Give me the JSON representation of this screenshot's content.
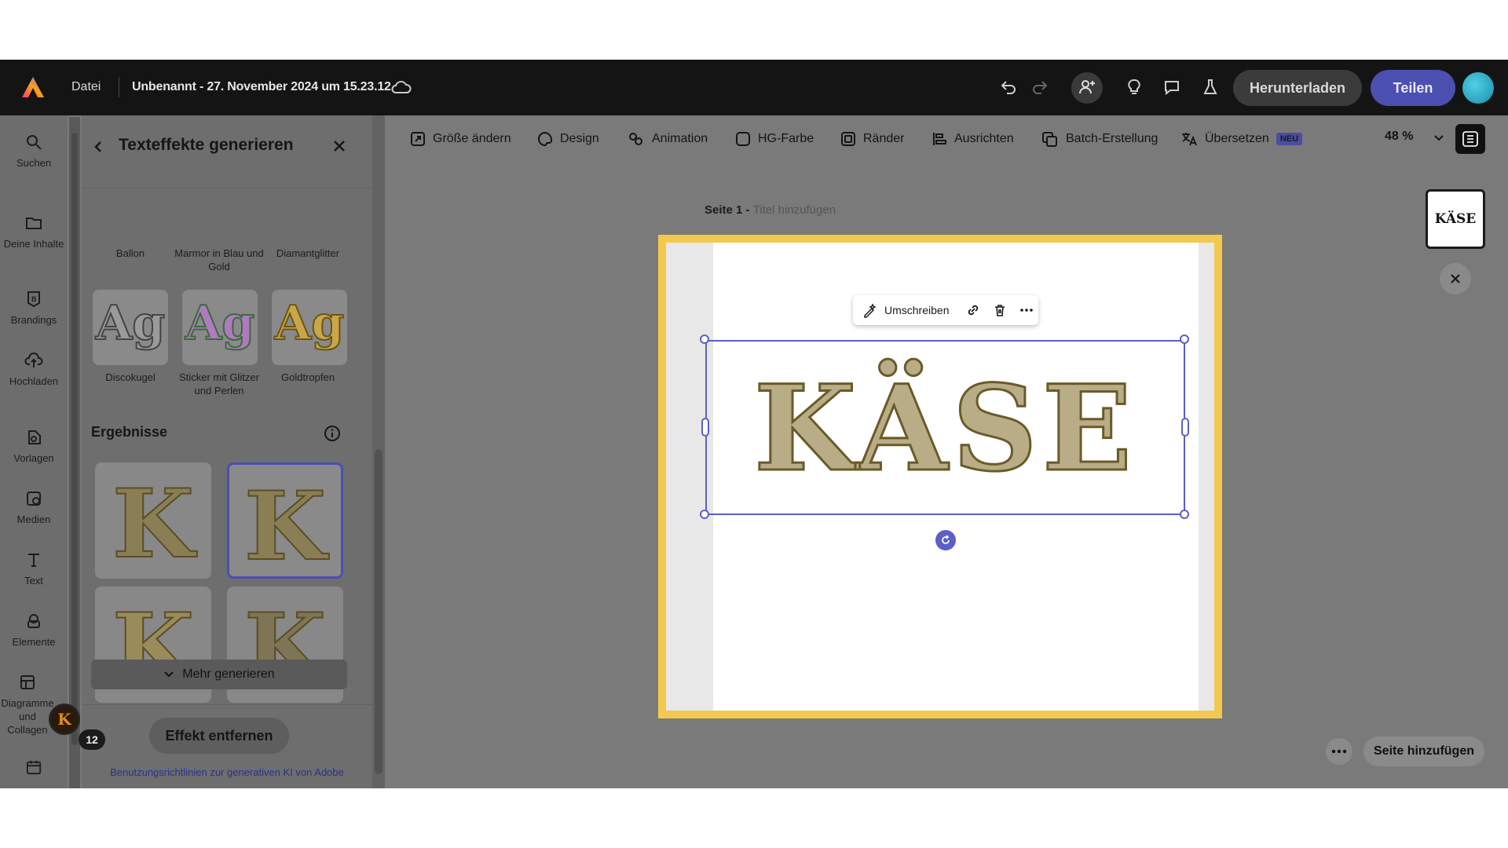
{
  "topbar": {
    "file_menu": "Datei",
    "doc_title": "Unbenannt - 27. November 2024 um 15.23.12",
    "download_label": "Herunterladen",
    "share_label": "Teilen"
  },
  "rail": {
    "items": [
      {
        "label": "Suchen",
        "icon": "search-icon"
      },
      {
        "label": "Deine Inhalte",
        "icon": "folder-icon"
      },
      {
        "label": "Brandings",
        "icon": "brand-icon"
      },
      {
        "label": "Hochladen",
        "icon": "upload-icon"
      },
      {
        "label": "Vorlagen",
        "icon": "templates-icon"
      },
      {
        "label": "Medien",
        "icon": "media-icon"
      },
      {
        "label": "Text",
        "icon": "text-icon"
      },
      {
        "label": "Elemente",
        "icon": "elements-icon"
      },
      {
        "label": "Diagramme und Collagen",
        "icon": "grid-icon"
      }
    ],
    "badge_count": "12",
    "avatar_letter": "K"
  },
  "panel": {
    "title": "Texteffekte generieren",
    "top_captions": [
      "Ballon",
      "Marmor in Blau und Gold",
      "Diamantglitter"
    ],
    "styles": [
      {
        "name": "Discokugel",
        "sample": "Ag",
        "color": "#9a9a9a"
      },
      {
        "name": "Sticker mit Glitzer und Perlen",
        "sample": "Ag",
        "color": "#b07ac0"
      },
      {
        "name": "Goldtropfen",
        "sample": "Ag",
        "color": "#c9a64a"
      }
    ],
    "results_title": "Ergebnisse",
    "result_letter": "K",
    "more_label": "Mehr generieren",
    "remove_label": "Effekt entfernen",
    "guidelines_link": "Benutzungsrichtlinien zur generativen KI von Adobe"
  },
  "toolbar": {
    "items": [
      "Größe ändern",
      "Design",
      "Animation",
      "HG-Farbe",
      "Ränder",
      "Ausrichten",
      "Batch-Erstellung",
      "Übersetzen"
    ],
    "new_badge": "NEU",
    "zoom": "48 %"
  },
  "canvas": {
    "page_label": "Seite 1 - ",
    "page_title_placeholder": "Titel hinzufügen",
    "text": "KÄSE",
    "context_menu_label": "Umschreiben",
    "add_page_label": "Seite hinzufügen",
    "thumb_text": "KÄSE"
  }
}
